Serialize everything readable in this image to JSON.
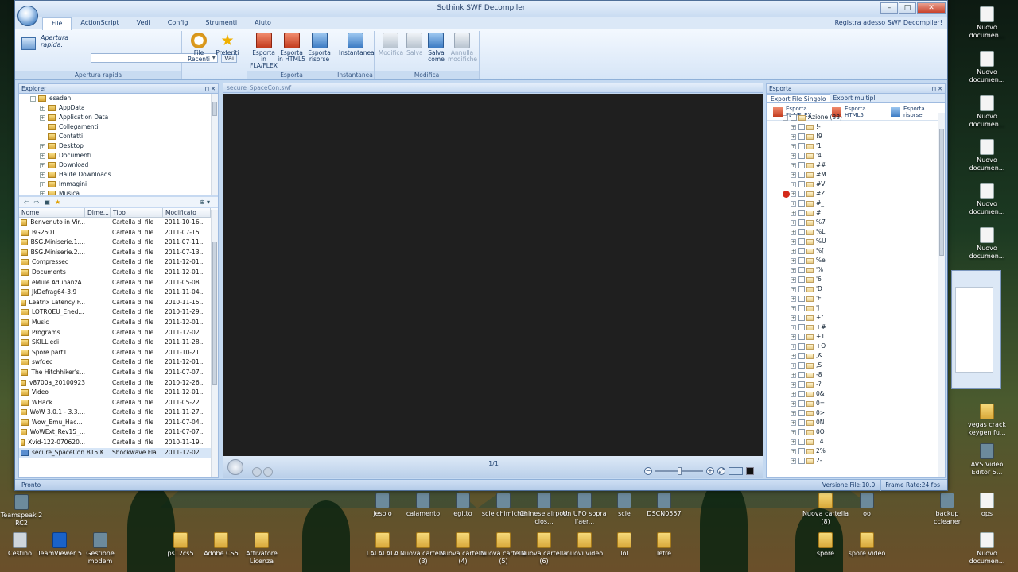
{
  "window": {
    "title": "Sothink SWF Decompiler",
    "minimize": "–",
    "maximize": "□",
    "close": "✕"
  },
  "menu": {
    "tabs": [
      "File",
      "ActionScript",
      "Vedi",
      "Config",
      "Strumenti",
      "Aiuto"
    ],
    "active_tab": "File",
    "register": "Registra adesso SWF Decompiler!"
  },
  "ribbon": {
    "quick_open": {
      "label": "Apertura rapida:",
      "value": "",
      "go": "Vai",
      "group": "Apertura rapida"
    },
    "recent": {
      "label1": "File",
      "label2": "Recenti"
    },
    "favorites": {
      "label": "Preferiti"
    },
    "export_group": "Esporta",
    "export_fla": {
      "label1": "Esporta",
      "label2": "in FLA/FLEX"
    },
    "export_html": {
      "label1": "Esporta",
      "label2": "in HTML5"
    },
    "export_res": {
      "label1": "Esporta",
      "label2": "risorse"
    },
    "snapshot_group": "Instantanea",
    "snapshot": {
      "label": "Instantanea"
    },
    "edit_group": "Modifica",
    "edit": {
      "label": "Modifica"
    },
    "save": {
      "label": "Salva"
    },
    "save_as": {
      "label1": "Salva",
      "label2": "come"
    },
    "undo": {
      "label1": "Annulla",
      "label2": "modifiche"
    }
  },
  "explorer": {
    "title": "Explorer",
    "tree": [
      {
        "label": "esaden",
        "depth": 0
      },
      {
        "label": "AppData",
        "depth": 1
      },
      {
        "label": "Application Data",
        "depth": 1
      },
      {
        "label": "Collegamenti",
        "depth": 1
      },
      {
        "label": "Contatti",
        "depth": 1
      },
      {
        "label": "Desktop",
        "depth": 1
      },
      {
        "label": "Documenti",
        "depth": 1
      },
      {
        "label": "Download",
        "depth": 1
      },
      {
        "label": "Halite Downloads",
        "depth": 1
      },
      {
        "label": "Immagini",
        "depth": 1
      },
      {
        "label": "Musica",
        "depth": 1
      }
    ],
    "columns": [
      "Nome",
      "Dime...",
      "Tipo",
      "Modificato"
    ],
    "files": [
      [
        "Benvenuto in Vir...",
        "",
        "Cartella di file",
        "2011-10-16..."
      ],
      [
        "BG2501",
        "",
        "Cartella di file",
        "2011-07-15..."
      ],
      [
        "BSG.Miniserie.1....",
        "",
        "Cartella di file",
        "2011-07-11..."
      ],
      [
        "BSG.Miniserie.2....",
        "",
        "Cartella di file",
        "2011-07-13..."
      ],
      [
        "Compressed",
        "",
        "Cartella di file",
        "2011-12-01..."
      ],
      [
        "Documents",
        "",
        "Cartella di file",
        "2011-12-01..."
      ],
      [
        "eMule AdunanzA",
        "",
        "Cartella di file",
        "2011-05-08..."
      ],
      [
        "JkDefrag64-3.9",
        "",
        "Cartella di file",
        "2011-11-04..."
      ],
      [
        "Leatrix Latency F...",
        "",
        "Cartella di file",
        "2010-11-15..."
      ],
      [
        "LOTROEU_Ened...",
        "",
        "Cartella di file",
        "2010-11-29..."
      ],
      [
        "Music",
        "",
        "Cartella di file",
        "2011-12-01..."
      ],
      [
        "Programs",
        "",
        "Cartella di file",
        "2011-12-02..."
      ],
      [
        "SKILL.edi",
        "",
        "Cartella di file",
        "2011-11-28..."
      ],
      [
        "Spore part1",
        "",
        "Cartella di file",
        "2011-10-21..."
      ],
      [
        "swfdec",
        "",
        "Cartella di file",
        "2011-12-01..."
      ],
      [
        "The Hitchhiker's...",
        "",
        "Cartella di file",
        "2011-07-07..."
      ],
      [
        "v8700a_20100923",
        "",
        "Cartella di file",
        "2010-12-26..."
      ],
      [
        "Video",
        "",
        "Cartella di file",
        "2011-12-01..."
      ],
      [
        "WHack",
        "",
        "Cartella di file",
        "2011-05-22..."
      ],
      [
        "WoW 3.0.1 - 3.3....",
        "",
        "Cartella di file",
        "2011-11-27..."
      ],
      [
        "Wow_Emu_Hac...",
        "",
        "Cartella di file",
        "2011-07-04..."
      ],
      [
        "WoWExt_Rev15_...",
        "",
        "Cartella di file",
        "2011-07-07..."
      ],
      [
        "Xvid-122-070620...",
        "",
        "Cartella di file",
        "2010-11-19..."
      ],
      [
        "secure_SpaceCon",
        "815 K",
        "Shockwave Fla...",
        "2011-12-02..."
      ]
    ]
  },
  "stage": {
    "tab": "secure_SpaceCon.swf",
    "frame": "1/1"
  },
  "export_pane": {
    "title": "Esporta",
    "tabs": [
      "Export File Singolo",
      "Export multipli"
    ],
    "buttons": [
      {
        "l1": "Esporta",
        "l2": "FLA/FLEX"
      },
      {
        "l1": "Esporta",
        "l2": "HTML5"
      },
      {
        "l1": "Esporta",
        "l2": "risorse"
      }
    ],
    "root": "Azione (88)",
    "items": [
      "!-",
      "!9",
      "'1",
      "'4",
      "##",
      "#M",
      "#V",
      "#Z",
      "#_",
      "#'",
      "%7",
      "%L",
      "%U",
      "%[",
      "%e",
      "'%",
      "'6",
      "'D",
      "'E",
      "'J",
      "+\"",
      "+#",
      "+1",
      "+O",
      ",&",
      ",S",
      "-8",
      "-?",
      "0&",
      "0=",
      "0>",
      "0N",
      "0O",
      "14",
      "2%",
      "2-"
    ]
  },
  "status": {
    "left": "Pronto",
    "version": "Versione File:10.0",
    "framerate": "Frame Rate:24 fps"
  },
  "desktop": {
    "right_icons": [
      "Nuovo documen...",
      "Nuovo documen...",
      "Nuovo documen...",
      "Nuovo documen...",
      "Nuovo documen...",
      "Nuovo documen..."
    ],
    "right_lower": [
      "vegas crack keygen fu...",
      "AVS Video Editor 5..."
    ],
    "bottom_row1": [
      "jesolo",
      "calamento",
      "egitto",
      "scie chimiche",
      "Chinese airport clos...",
      "Un UFO sopra l'aer...",
      "scie",
      "DSCN0557",
      "Nuova cartella (8)",
      "oo",
      "backup ccleaner",
      "ops"
    ],
    "bottom_row2": [
      "Cestino",
      "TeamViewer 5",
      "Gestione modem",
      "ps12cs5",
      "Adobe CS5",
      "Attivatore Licenza",
      "LALALALA",
      "Nuova cartella (3)",
      "Nuova cartella (4)",
      "Nuova cartella (5)",
      "Nuova cartella (6)",
      "nuovi video",
      "lol",
      "lefre",
      "spore",
      "spore video",
      "Nuovo documen..."
    ],
    "left_label": "Teamspeak 2 RC2"
  }
}
